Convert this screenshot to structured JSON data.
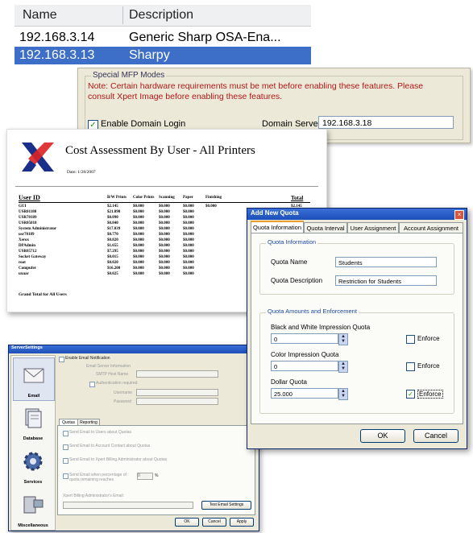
{
  "device_list": {
    "columns": [
      "Name",
      "Description"
    ],
    "rows": [
      {
        "name": "192.168.3.14",
        "description": "Generic Sharp OSA-Ena..."
      },
      {
        "name": "192.168.3.13",
        "description": "Sharpy"
      }
    ],
    "selected_index": 1
  },
  "mfp_modes": {
    "legend": "Special MFP Modes",
    "note": "Note:  Certain hardware requirements must be met before enabling these features.  Please consult Xpert Image before enabling these features.",
    "enable_domain_login_label": "Enable Domain Login",
    "enable_domain_login_checked": true,
    "domain_server_label": "Domain Server:",
    "domain_server_value": "192.168.3.18"
  },
  "report": {
    "title": "Cost Assessment By User -  All Printers",
    "date": "Date:  1/28/2007",
    "columns": [
      "User ID",
      "B/W Prints",
      "Color Prints",
      "Scanning",
      "Paper",
      "Finishing",
      "Total"
    ],
    "rows": [
      [
        "GUI",
        "$2.145",
        "$0.000",
        "$0.000",
        "$0.000",
        "$0.000",
        "$2.145"
      ],
      [
        "USR01180",
        "$21.090",
        "$0.000",
        "$0.000",
        "$0.000",
        "",
        ""
      ],
      [
        "USR70189",
        "$0.090",
        "$0.000",
        "$0.000",
        "$0.000",
        "",
        ""
      ],
      [
        "USR05018",
        "$0.840",
        "$0.000",
        "$0.000",
        "$0.000",
        "",
        ""
      ],
      [
        "System Administrator",
        "$17.039",
        "$0.000",
        "$0.000",
        "$0.000",
        "",
        ""
      ],
      [
        "usr70189",
        "$0.770",
        "$0.000",
        "$0.000",
        "$0.000",
        "",
        ""
      ],
      [
        "Xerox",
        "$0.820",
        "$0.000",
        "$0.000",
        "$0.000",
        "",
        ""
      ],
      [
        "DPAdmin",
        "$1.655",
        "$0.000",
        "$0.000",
        "$0.000",
        "",
        ""
      ],
      [
        "USR05712",
        "$7.295",
        "$0.000",
        "$0.000",
        "$0.000",
        "",
        ""
      ],
      [
        "Socket Gateway",
        "$0.015",
        "$0.000",
        "$0.000",
        "$0.000",
        "",
        ""
      ],
      [
        "root",
        "$0.020",
        "$0.000",
        "$0.000",
        "$0.000",
        "",
        ""
      ],
      [
        "Compufer",
        "$16.200",
        "$0.000",
        "$0.000",
        "$0.000",
        "",
        ""
      ],
      [
        "uxuar",
        "$0.025",
        "$0.000",
        "$0.000",
        "$0.000",
        "",
        ""
      ]
    ],
    "grand_total_label": "Grand Total for All Users"
  },
  "quota_dialog": {
    "title": "Add New Quota",
    "tabs": [
      "Quota Information",
      "Quota Interval",
      "User Assignment",
      "Account Assignment"
    ],
    "active_tab": 0,
    "info_legend": "Quota Information",
    "name_label": "Quota Name",
    "name_value": "Students",
    "desc_label": "Quota Description",
    "desc_value": "Restriction for Students",
    "amounts_legend": "Quota Amounts and Enforcement",
    "bw_label": "Black and White Impression Quota",
    "bw_value": "0",
    "bw_enforce": false,
    "color_label": "Color Impression Quota",
    "color_value": "0",
    "color_enforce": false,
    "dollar_label": "Dollar Quota",
    "dollar_value": "25.000",
    "dollar_enforce": true,
    "enforce_label": "Enforce",
    "ok_label": "OK",
    "cancel_label": "Cancel"
  },
  "email_settings": {
    "title": "ServerSettings",
    "sidebar": [
      "Email",
      "Database",
      "Services",
      "Miscellaneous"
    ],
    "enable_notification_label": "Enable Email Notification",
    "server_info_legend": "Email Server Information",
    "smtp_label": "SMTP Host Name",
    "auth_label": "Authentication required",
    "username_label": "Username",
    "password_label": "Password",
    "tabs": [
      "Quotas",
      "Reporting"
    ],
    "options": [
      "Send Email to Users about Quotas",
      "Send Email to Account Contact about Quotas",
      "Send Email to Xpert Billing Administrator about Quotas",
      "Send Email when percentage of quota remaining reaches"
    ],
    "percent_value": "0",
    "percent_unit": "%",
    "admin_email_label": "Xpert Billing Administrator's Email:",
    "test_button": "Test Email Settings",
    "ok_label": "OK",
    "cancel_label": "Cancel",
    "apply_label": "Apply"
  }
}
